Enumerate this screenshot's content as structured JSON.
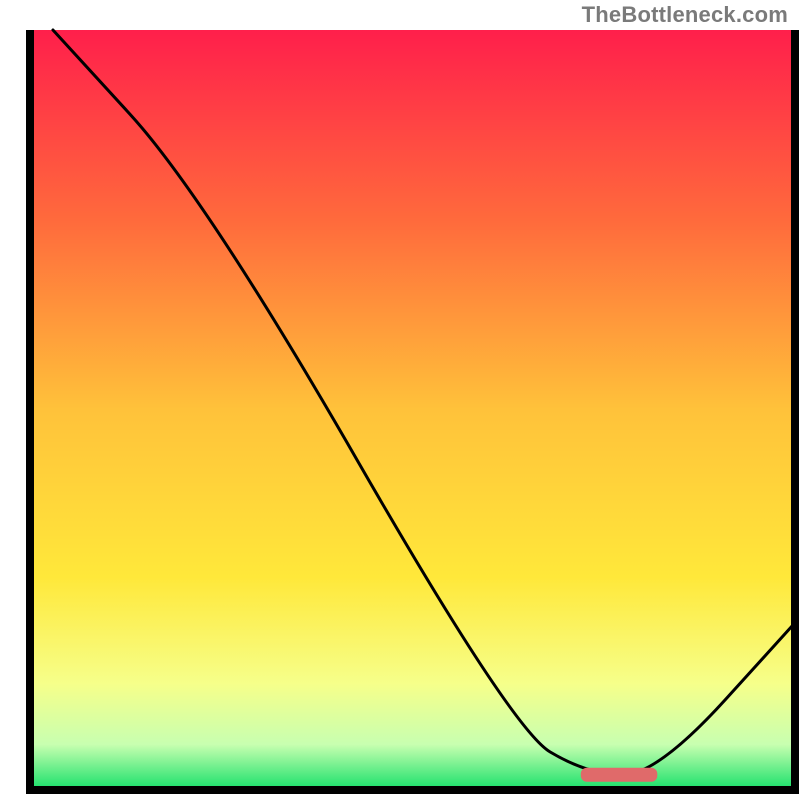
{
  "watermark": "TheBottleneck.com",
  "chart_data": {
    "type": "line",
    "title": "",
    "xlabel": "",
    "ylabel": "",
    "xlim": [
      0,
      100
    ],
    "ylim": [
      0,
      100
    ],
    "x": [
      3,
      23,
      63,
      73,
      82,
      100
    ],
    "values": [
      100,
      78,
      8,
      2,
      2,
      22
    ],
    "marker": {
      "x_start": 72,
      "x_end": 82,
      "y": 2
    },
    "gradient_stops": [
      {
        "offset": 0,
        "color": "#ff1f4b"
      },
      {
        "offset": 25,
        "color": "#ff6a3c"
      },
      {
        "offset": 50,
        "color": "#ffc23a"
      },
      {
        "offset": 72,
        "color": "#ffe83a"
      },
      {
        "offset": 86,
        "color": "#f6ff8a"
      },
      {
        "offset": 94,
        "color": "#c8ffb0"
      },
      {
        "offset": 100,
        "color": "#17e06a"
      }
    ]
  }
}
